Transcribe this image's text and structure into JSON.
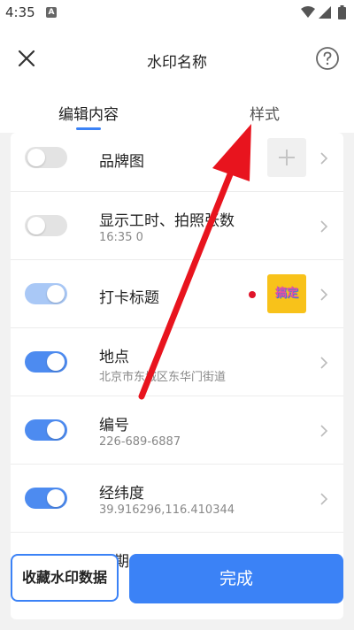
{
  "status_bar": {
    "time": "4:35",
    "notification_badge": "A"
  },
  "header": {
    "title": "水印名称"
  },
  "tabs": [
    {
      "label": "编辑内容",
      "active": true
    },
    {
      "label": "样式",
      "active": false
    }
  ],
  "rows": [
    {
      "label": "品牌图",
      "subtitle": "",
      "toggle": "off"
    },
    {
      "label": "显示工时、拍照张数",
      "subtitle": "16:35  0",
      "toggle": "off"
    },
    {
      "label": "打卡标题",
      "subtitle": "",
      "toggle": "on-light",
      "badge_text": "搞定"
    },
    {
      "label": "地点",
      "subtitle": "北京市东城区东华门街道",
      "toggle": "on"
    },
    {
      "label": "编号",
      "subtitle": "226-689-6887",
      "toggle": "on"
    },
    {
      "label": "经纬度",
      "subtitle": "39.916296,116.410344",
      "toggle": "on"
    },
    {
      "label": "日期",
      "subtitle": "",
      "toggle": "on"
    }
  ],
  "footer": {
    "favorite_label": "收藏水印数据",
    "done_label": "完成"
  },
  "colors": {
    "accent": "#3b82f6",
    "red_dot": "#e0142a",
    "annotation_arrow": "#e8141e"
  }
}
